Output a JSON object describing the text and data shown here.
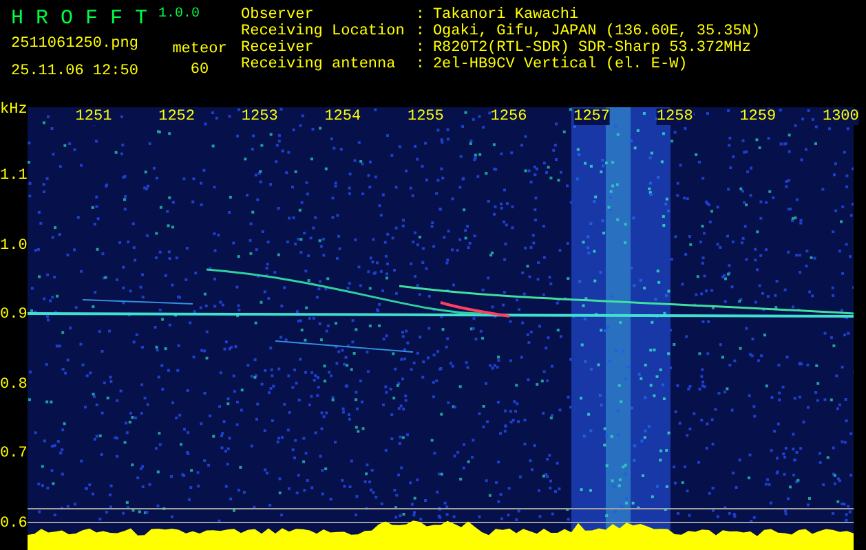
{
  "app": {
    "title": "H R O F F T",
    "version": "1.0.0"
  },
  "file": {
    "name": "2511061250.png",
    "timestamp": "25.11.06 12:50"
  },
  "count": {
    "label": "meteor",
    "value": "60"
  },
  "info": [
    {
      "label": "Observer",
      "value": "Takanori Kawachi"
    },
    {
      "label": "Receiving Location",
      "value": "Ogaki, Gifu, JAPAN (136.60E, 35.35N)"
    },
    {
      "label": "Receiver",
      "value": "R820T2(RTL-SDR) SDR-Sharp 53.372MHz"
    },
    {
      "label": "Receiving antenna",
      "value": "2el-HB9CV Vertical (el. E-W)"
    }
  ],
  "separator": ":",
  "plot": {
    "y_unit": "kHz",
    "y_labels": [
      "1.1",
      "1.0",
      "0.9",
      "0.8",
      "0.7",
      "0.6"
    ],
    "time_labels": [
      "1251",
      "1252",
      "1253",
      "1254",
      "1255",
      "1256",
      "1257",
      "1258",
      "1259",
      "1300"
    ]
  }
}
